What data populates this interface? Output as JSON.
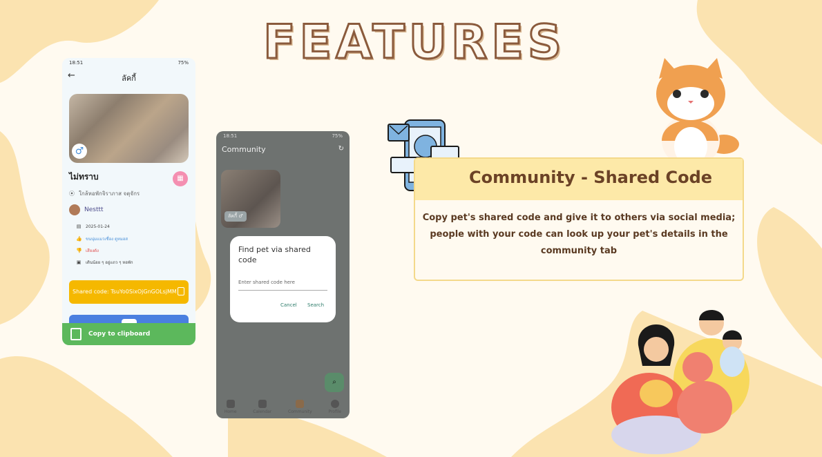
{
  "page_title": "FEATURES",
  "colors": {
    "background": "#fffaf0",
    "blob": "#fbe3b0",
    "accent_yellow": "#f5b800",
    "toast_green": "#5cb85c",
    "title_brown": "#6b4226"
  },
  "phone1": {
    "status_time": "18:51",
    "status_right": "75%",
    "header_title": "ลัคกี้",
    "pet_name": "ไม่ทราบ",
    "location": "ใกล้หอพักจิราภาส จตุจักร",
    "owner": "Nesttt",
    "birth_date": "2025-01-24",
    "likes": "ขนนุ่มแมวเชื่อง ดูหมอส",
    "dislikes": "เสียงดัง",
    "habit": "เดินน้อย ๆ อยู่แถว ๆ หอพัก",
    "shared_code": "Shared code: TsuYo0SixOjGnGOLsjMM",
    "toast": "Copy to clipboard"
  },
  "phone2": {
    "status_time": "18:51",
    "status_right": "75%",
    "title": "Community",
    "tile_label": "ลัคกี้ ♂",
    "dialog": {
      "title": "Find pet via shared code",
      "placeholder": "Enter shared code here",
      "cancel": "Cancel",
      "search": "Search"
    },
    "nav": [
      {
        "label": "Home",
        "icon": "home-icon"
      },
      {
        "label": "Calendar",
        "icon": "calendar-icon"
      },
      {
        "label": "Community",
        "icon": "community-icon"
      },
      {
        "label": "Profile",
        "icon": "profile-icon"
      }
    ]
  },
  "feature": {
    "title": "Community - Shared Code",
    "body": "Copy pet's shared code and give it to others via social media; people with your code can look up your pet's details in the community tab"
  }
}
